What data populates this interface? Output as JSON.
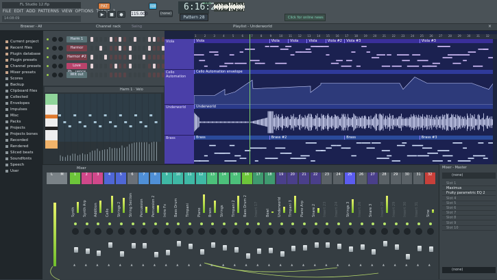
{
  "window": {
    "title": "FL Studio 12.flp"
  },
  "menu": [
    "FILE",
    "EDIT",
    "ADD",
    "PATTERNS",
    "VIEW",
    "OPTIONS",
    "TOOLS",
    "?"
  ],
  "hint": "14:08:09",
  "transport": {
    "mode": "PAT",
    "tempo": "115.000",
    "time": "6:16:20",
    "time_unit": "M:S:CS",
    "snap": "(none)",
    "pattern": "Pattern 28",
    "news": "Click for online news"
  },
  "toolbar": {
    "browser_label": "Browser - All",
    "channel_rack_label": "Channel rack",
    "swing_label": "Swing",
    "playlist_label": "Playlist - Underworld"
  },
  "browser": {
    "items": [
      "Current project",
      "Recent files",
      "Plugin database",
      "Plugin presets",
      "Channel presets",
      "Mixer presets",
      "Scores",
      "Backup",
      "Clipboard files",
      "Collected",
      "Envelopes",
      "Impulses",
      "Misc",
      "Packs",
      "Projects",
      "Projects bones",
      "Recorded",
      "Rendered",
      "Sliced beats",
      "Soundfonts",
      "Speech",
      "User"
    ]
  },
  "channel_rack": {
    "channels": [
      {
        "name": "Harm 1",
        "color": "#5c7478",
        "steps": [
          1,
          0,
          0,
          0,
          1,
          0,
          1,
          0,
          0,
          1,
          0,
          0,
          1,
          1,
          0,
          0
        ]
      },
      {
        "name": "Harmor",
        "color": "#7a3d48",
        "steps": [
          0,
          0,
          1,
          0,
          0,
          0,
          1,
          0,
          1,
          0,
          0,
          0,
          1,
          0,
          0,
          1
        ]
      },
      {
        "name": "Harmor #2",
        "color": "#7a3d48",
        "steps": [
          1,
          0,
          0,
          1,
          0,
          0,
          0,
          0,
          1,
          0,
          0,
          1,
          0,
          0,
          0,
          0
        ]
      },
      {
        "name": "Love Ph...uence",
        "color": "#b9436b",
        "steps": [
          1,
          0,
          0,
          0,
          0,
          1,
          0,
          0,
          1,
          0,
          0,
          0,
          0,
          1,
          0,
          0
        ]
      },
      {
        "name": "Wilt out",
        "color": "#5c7478",
        "steps": [
          0,
          0,
          0,
          0,
          0,
          0,
          0,
          0,
          0,
          0,
          0,
          0,
          0,
          0,
          0,
          0
        ]
      }
    ]
  },
  "piano_roll": {
    "title": "Harm 1 · Velo"
  },
  "playlist": {
    "bars": 32,
    "playhead_bar": 6.9,
    "tracks": [
      {
        "name": "Viola",
        "type": "notes",
        "clips": [
          {
            "label": "Viola",
            "start": 1
          },
          {
            "label": "Viola",
            "start": 9
          },
          {
            "label": "Viola",
            "start": 11
          },
          {
            "label": "Viola",
            "start": 13
          },
          {
            "label": "Viola #2",
            "start": 15
          },
          {
            "label": "Viola #3",
            "start": 17
          },
          {
            "label": "Viola #3",
            "start": 25
          }
        ]
      },
      {
        "name": "Cello Automation",
        "type": "automation",
        "clips": [
          {
            "label": "Cello Automation envelope",
            "start": 1
          }
        ]
      },
      {
        "name": "Underworld",
        "type": "audio",
        "clips": [
          {
            "label": "Underworld",
            "start": 1
          }
        ]
      },
      {
        "name": "Brass",
        "type": "notes2",
        "clips": [
          {
            "label": "Brass",
            "start": 1
          },
          {
            "label": "Brass #2",
            "start": 9
          },
          {
            "label": "Brass",
            "start": 17
          },
          {
            "label": "Brass #3",
            "start": 25
          }
        ]
      }
    ]
  },
  "mixer": {
    "title": "Mixer",
    "master": {
      "labels": [
        "L",
        "M"
      ],
      "level": 0.85
    },
    "inserts": [
      {
        "name": "Synth",
        "color": "#6dc53a",
        "level": 0.35
      },
      {
        "name": "Synth Arp",
        "color": "#d0488a",
        "level": 0
      },
      {
        "name": "Addition",
        "color": "#d0488a",
        "level": 0.4
      },
      {
        "name": "Cello",
        "color": "#4f67d6",
        "level": 0.55
      },
      {
        "name": "Strings 2",
        "color": "#4f67d6",
        "level": 0.5
      },
      {
        "name": "String Section",
        "color": "#6a7078",
        "level": 0
      },
      {
        "name": "Percussion",
        "color": "#4f8fd6",
        "level": 0.2
      },
      {
        "name": "Percussion 2",
        "color": "#4f8fd6",
        "level": 0.25
      },
      {
        "name": "Intro Fx",
        "color": "#3fb8a5",
        "level": 0
      },
      {
        "name": "Bass Drum",
        "color": "#3fb8a5",
        "level": 0
      },
      {
        "name": "Timpani",
        "color": "#3fb8a5",
        "level": 0
      },
      {
        "name": "Piano",
        "color": "#3fb8a5",
        "level": 0.6
      },
      {
        "name": "Brass",
        "color": "#4cc07a",
        "level": 0.4
      },
      {
        "name": "Strings",
        "color": "#4cc07a",
        "level": 0
      },
      {
        "name": "Timpani 2",
        "color": "#4cc07a",
        "level": 0.55
      },
      {
        "name": "Bass Drum 2",
        "color": "#6dc53a",
        "level": 0
      },
      {
        "name": "Insert 17",
        "color": "#3f9a6f",
        "level": 0
      },
      {
        "name": "Bowl",
        "color": "#3f9a6f",
        "level": 0.05
      },
      {
        "name": "Underworld",
        "color": "#4a3f8a",
        "level": 0.2
      },
      {
        "name": "Timpani 3",
        "color": "#4a3f8a",
        "level": 0.55
      },
      {
        "name": "Piano Arp",
        "color": "#4a3f8a",
        "level": 0
      },
      {
        "name": "Snare 2",
        "color": "#4a3f8a",
        "level": 0.15
      },
      {
        "name": "Insert 23",
        "color": "#5a6166",
        "level": 0
      },
      {
        "name": "Insert 24",
        "color": "#5a6166",
        "level": 0
      },
      {
        "name": "Strings 3",
        "color": "#5b5cf0",
        "level": 0.45
      },
      {
        "name": "Insert 26",
        "color": "#5a6166",
        "level": 0
      },
      {
        "name": "Snare 3",
        "color": "#4a3f8a",
        "level": 0
      },
      {
        "name": "Insert 28",
        "color": "#5a6166",
        "level": 0.55
      },
      {
        "name": "Insert 29",
        "color": "#5a6166",
        "level": 0
      },
      {
        "name": "Insert 30",
        "color": "#5a6166",
        "level": 0
      },
      {
        "name": "Insert 31",
        "color": "#5a6166",
        "level": 0
      },
      {
        "name": "Sine",
        "color": "#c8403a",
        "level": 0.12
      }
    ]
  },
  "mixer_panel": {
    "title": "Mixer - Master",
    "input": "(none)",
    "slots": [
      "Slot 1",
      "Maximus",
      "Fruity parametric EQ 2",
      "Slot 4",
      "Slot 5",
      "Slot 6",
      "Slot 7",
      "Slot 8",
      "Slot 9",
      "Slot 10"
    ],
    "output": "(none)"
  }
}
